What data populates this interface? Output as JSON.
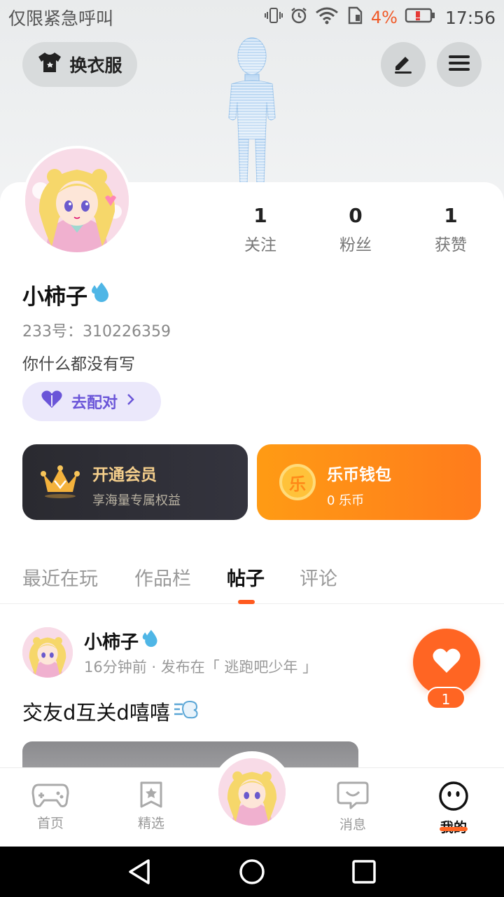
{
  "status_bar": {
    "carrier": "仅限紧急呼叫",
    "battery_percent": "4%",
    "time": "17:56",
    "icons": [
      "vibrate-icon",
      "alarm-icon",
      "wifi-icon",
      "sim-icon",
      "battery-low-icon"
    ]
  },
  "header": {
    "outfit_button": "换衣服",
    "edit_icon": "pen-icon",
    "menu_icon": "hamburger-menu-icon"
  },
  "profile": {
    "stats": [
      {
        "num": "1",
        "label": "关注"
      },
      {
        "num": "0",
        "label": "粉丝"
      },
      {
        "num": "1",
        "label": "获赞"
      }
    ],
    "nickname": "小柿子",
    "uid": "233号：310226359",
    "bio": "你什么都没有写",
    "match_button": "去配对"
  },
  "cards": {
    "vip": {
      "title": "开通会员",
      "subtitle": "享海量专属权益",
      "title_color": "#f5cf8c",
      "sub_color": "#b9b2a2"
    },
    "wallet": {
      "title": "乐币钱包",
      "subtitle": "0 乐币",
      "coin_glyph": "乐"
    }
  },
  "tabs": [
    {
      "label": "最近在玩",
      "active": false
    },
    {
      "label": "作品栏",
      "active": false
    },
    {
      "label": "帖子",
      "active": true
    },
    {
      "label": "评论",
      "active": false
    }
  ],
  "post": {
    "author": "小柿子",
    "meta": "16分钟前 · 发布在「 逃跑吧少年 」",
    "text": "交友d互关d嘻嘻",
    "like_count": "1"
  },
  "bottom_nav": [
    {
      "label": "首页",
      "icon": "gamepad-icon",
      "active": false
    },
    {
      "label": "精选",
      "icon": "star-bookmark-icon",
      "active": false
    },
    {
      "label": "消息",
      "icon": "chat-bubble-icon",
      "active": false
    },
    {
      "label": "我的",
      "icon": "face-icon",
      "active": true
    }
  ],
  "colors": {
    "accent": "#ff6523",
    "match_purple": "#6a55d8",
    "wallet_orange": "#ff8a18"
  }
}
